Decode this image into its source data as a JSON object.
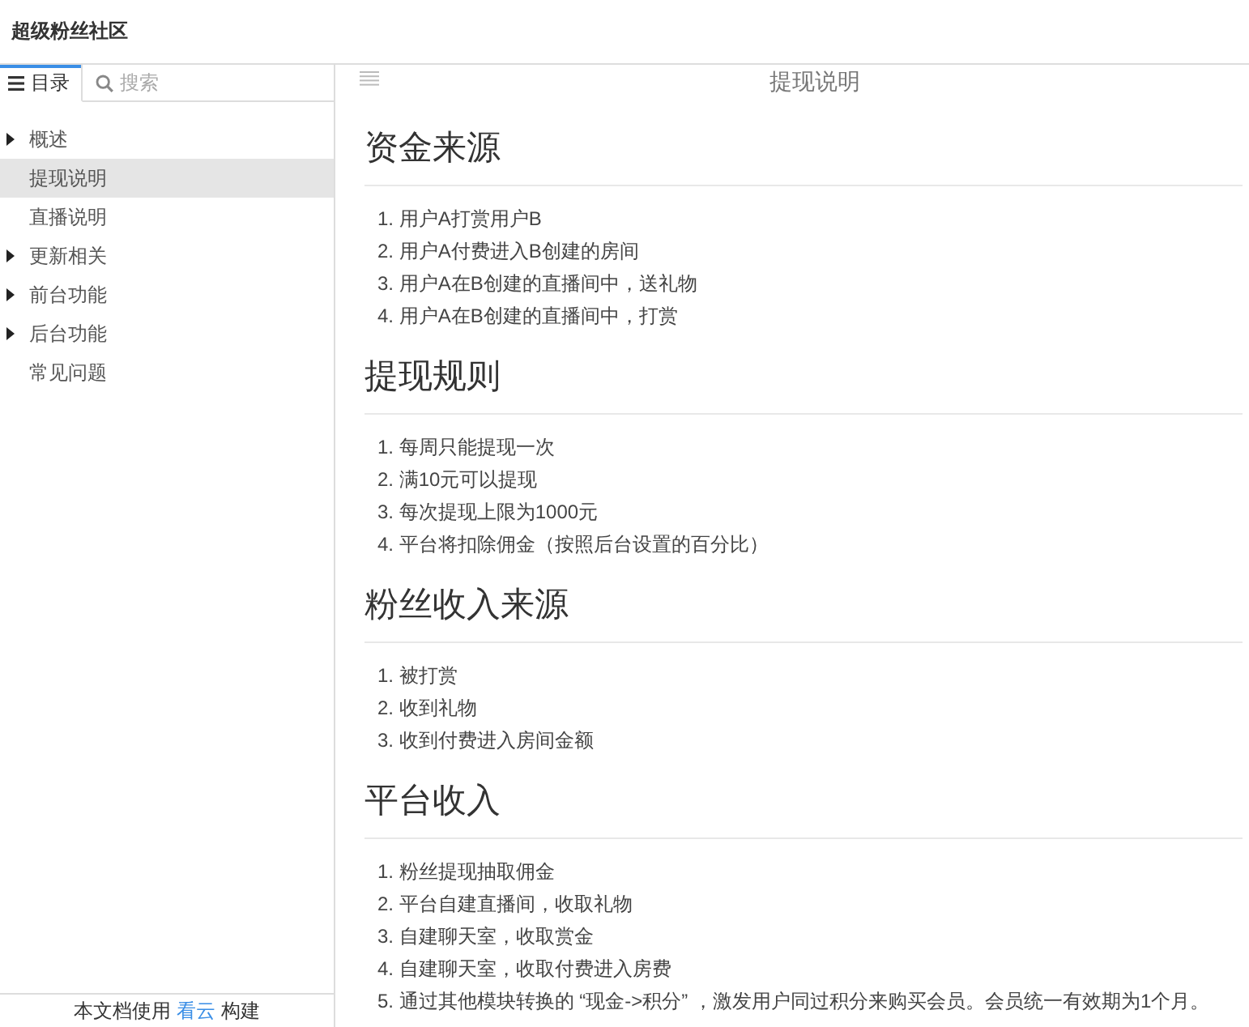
{
  "header": {
    "title": "超级粉丝社区"
  },
  "sidebar": {
    "tabs": [
      {
        "label": "目录",
        "selected": true
      }
    ],
    "search": {
      "placeholder": "搜索"
    },
    "items": [
      {
        "label": "概述",
        "kind": "group",
        "expanded": false,
        "selected": false
      },
      {
        "label": "提现说明",
        "kind": "page",
        "selected": true
      },
      {
        "label": "直播说明",
        "kind": "page",
        "selected": false
      },
      {
        "label": "更新相关",
        "kind": "group",
        "expanded": false,
        "selected": false
      },
      {
        "label": "前台功能",
        "kind": "group",
        "expanded": false,
        "selected": false
      },
      {
        "label": "后台功能",
        "kind": "group",
        "expanded": false,
        "selected": false
      },
      {
        "label": "常见问题",
        "kind": "page",
        "selected": false
      }
    ],
    "footer": {
      "before": "本文档使用",
      "link": "看云",
      "after": "构建"
    }
  },
  "content": {
    "title": "提现说明",
    "sections": [
      {
        "heading": "资金来源",
        "items": [
          "1. 用户A打赏用户B",
          "2. 用户A付费进入B创建的房间",
          "3. 用户A在B创建的直播间中，送礼物",
          "4. 用户A在B创建的直播间中，打赏"
        ]
      },
      {
        "heading": "提现规则",
        "items": [
          "1. 每周只能提现一次",
          "2. 满10元可以提现",
          "3. 每次提现上限为1000元",
          "4. 平台将扣除佣金（按照后台设置的百分比）"
        ]
      },
      {
        "heading": "粉丝收入来源",
        "items": [
          "1. 被打赏",
          "2. 收到礼物",
          "3. 收到付费进入房间金额"
        ]
      },
      {
        "heading": "平台收入",
        "items": [
          "1. 粉丝提现抽取佣金",
          "2. 平台自建直播间，收取礼物",
          "3. 自建聊天室，收取赏金",
          "4. 自建聊天室，收取付费进入房费",
          "5. 通过其他模块转换的 “现金->积分” ，激发用户同过积分来购买会员。会员统一有效期为1个月。"
        ]
      }
    ]
  }
}
